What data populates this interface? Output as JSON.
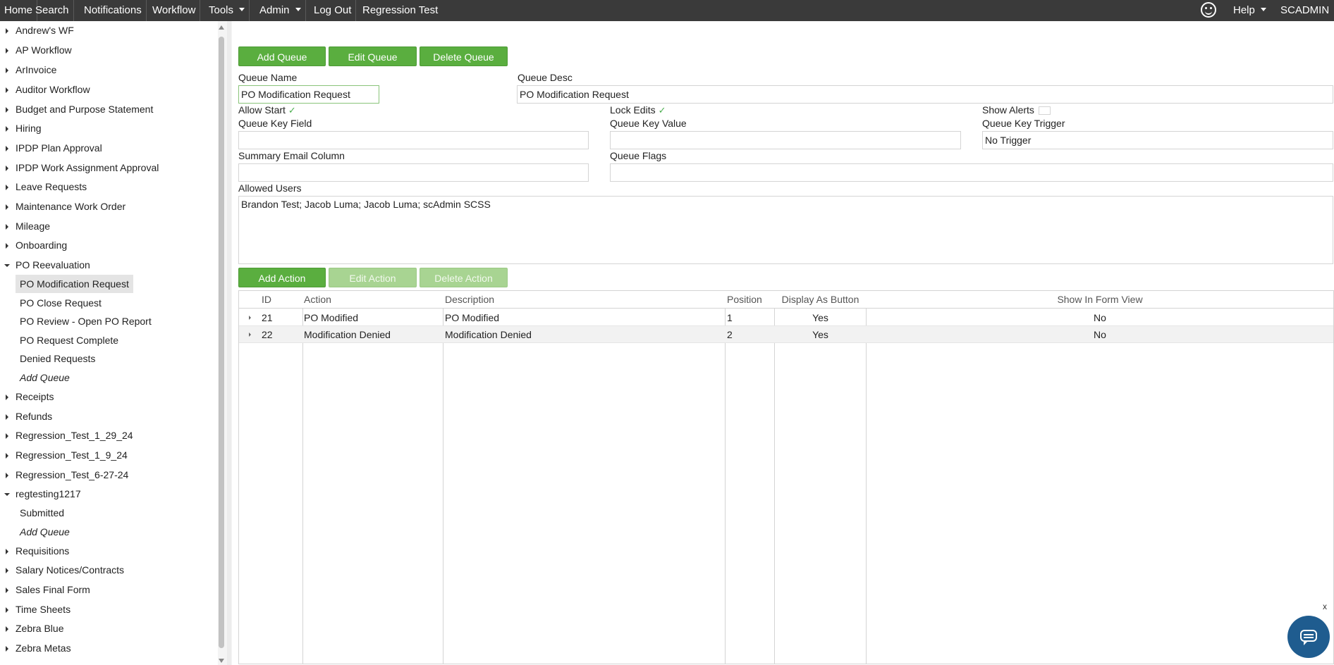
{
  "topnav": {
    "home": "Home",
    "search": "Search",
    "notifications": "Notifications",
    "workflow": "Workflow",
    "tools": "Tools",
    "admin": "Admin",
    "logout": "Log Out",
    "app_title": "Regression Test",
    "feedback_icon": "smiley-icon",
    "help": "Help",
    "user": "SCADMIN"
  },
  "sidebar": {
    "workflows": [
      "Andrew's WF",
      "AP Workflow",
      "ArInvoice",
      "Auditor Workflow",
      "Budget and Purpose Statement",
      "Hiring",
      "IPDP Plan Approval",
      "IPDP Work Assignment Approval",
      "Leave Requests",
      "Maintenance Work Order",
      "Mileage",
      "Onboarding",
      "PO Reevaluation",
      "Receipts",
      "Refunds",
      "Regression_Test_1_29_24",
      "Regression_Test_1_9_24",
      "Regression_Test_6-27-24",
      "regtesting1217",
      "Requisitions",
      "Salary Notices/Contracts",
      "Sales Final Form",
      "Time Sheets",
      "Zebra Blue",
      "Zebra Metas"
    ],
    "po_queues": [
      "PO Modification Request",
      "PO Close Request",
      "PO Review - Open PO Report",
      "PO Request Complete",
      "Denied Requests"
    ],
    "po_add_queue": "Add Queue",
    "regtesting_queues": [
      "Submitted"
    ],
    "regtesting_add_queue": "Add Queue",
    "selected": "PO Modification Request"
  },
  "queue_toolbar": {
    "add": "Add Queue",
    "edit": "Edit Queue",
    "delete": "Delete Queue"
  },
  "form": {
    "queue_name_label": "Queue Name",
    "queue_name": "PO Modification Request",
    "queue_desc_label": "Queue Desc",
    "queue_desc": "PO Modification Request",
    "allow_start_label": "Allow Start",
    "allow_start_check": "✓",
    "lock_edits_label": "Lock Edits",
    "lock_edits_check": "✓",
    "show_alerts_label": "Show Alerts",
    "queue_key_field_label": "Queue Key Field",
    "queue_key_field": "",
    "queue_key_value_label": "Queue Key Value",
    "queue_key_value": "",
    "queue_key_trigger_label": "Queue Key Trigger",
    "queue_key_trigger": "No Trigger",
    "summary_email_label": "Summary Email Column",
    "summary_email": "",
    "queue_flags_label": "Queue Flags",
    "queue_flags": "",
    "allowed_users_label": "Allowed Users",
    "allowed_users": "Brandon Test; Jacob Luma; Jacob Luma; scAdmin SCSS"
  },
  "action_toolbar": {
    "add": "Add Action",
    "edit": "Edit Action",
    "delete": "Delete Action"
  },
  "actions_table": {
    "headers": [
      "ID",
      "Action",
      "Description",
      "Position",
      "Display As Button",
      "Show In Form View"
    ],
    "rows": [
      {
        "id": "21",
        "action": "PO Modified",
        "description": "PO Modified",
        "position": "1",
        "display_as_button": "Yes",
        "show_in_form_view": "No"
      },
      {
        "id": "22",
        "action": "Modification Denied",
        "description": "Modification Denied",
        "position": "2",
        "display_as_button": "Yes",
        "show_in_form_view": "No"
      }
    ]
  },
  "chat": {
    "close_label": "x",
    "icon": "chat-icon"
  }
}
